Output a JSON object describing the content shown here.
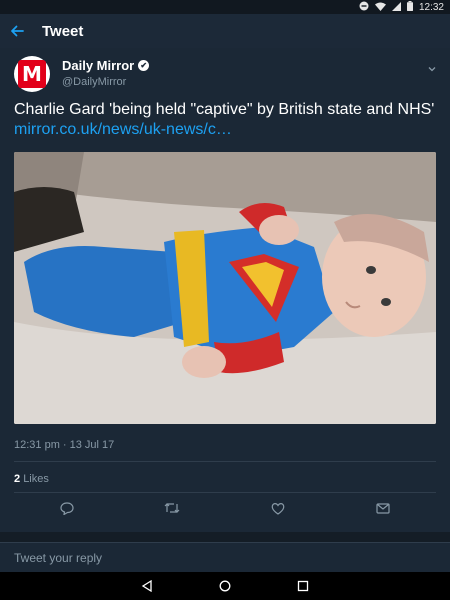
{
  "status_bar": {
    "time": "12:32",
    "icons": [
      "minus-circle-icon",
      "wifi-icon",
      "signal-icon",
      "battery-icon"
    ]
  },
  "app_bar": {
    "title": "Tweet",
    "back_icon": "arrow-left-icon"
  },
  "tweet": {
    "author": {
      "name": "Daily Mirror",
      "handle": "@DailyMirror",
      "verified": true,
      "avatar_letter": "M",
      "brand_color": "#e2001a"
    },
    "text": "Charlie Gard 'being held \"captive\" by British state and NHS'",
    "link_text": "mirror.co.uk/news/uk-news/c…",
    "timestamp": "12:31 pm · 13 Jul 17",
    "likes_count": "2",
    "likes_label": "Likes",
    "actions": [
      "reply-icon",
      "retweet-icon",
      "like-icon",
      "message-icon"
    ]
  },
  "reply": {
    "placeholder": "Tweet your reply"
  },
  "colors": {
    "background": "#141d26",
    "card": "#1b2836",
    "link": "#1da1f2",
    "muted": "#8899a6"
  }
}
